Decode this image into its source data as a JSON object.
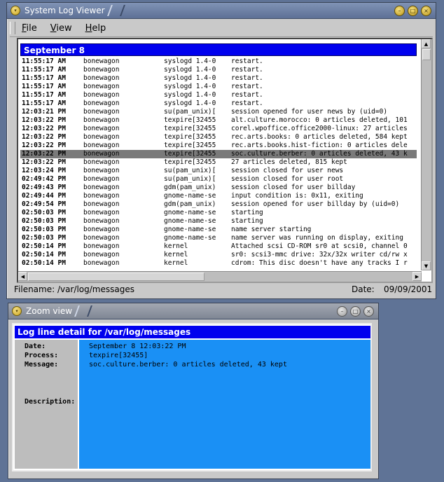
{
  "main_window": {
    "title": "System Log Viewer",
    "menu": [
      {
        "underline": "F",
        "rest": "ile"
      },
      {
        "underline": "V",
        "rest": "iew"
      },
      {
        "underline": "H",
        "rest": "elp"
      }
    ],
    "date_header": "September  8",
    "rows": [
      [
        "11:55:17 AM",
        "bonewagon",
        "syslogd 1.4-0",
        "restart."
      ],
      [
        "11:55:17 AM",
        "bonewagon",
        "syslogd 1.4-0",
        "restart."
      ],
      [
        "11:55:17 AM",
        "bonewagon",
        "syslogd 1.4-0",
        "restart."
      ],
      [
        "11:55:17 AM",
        "bonewagon",
        "syslogd 1.4-0",
        "restart."
      ],
      [
        "11:55:17 AM",
        "bonewagon",
        "syslogd 1.4-0",
        "restart."
      ],
      [
        "11:55:17 AM",
        "bonewagon",
        "syslogd 1.4-0",
        "restart."
      ],
      [
        "12:03:21 PM",
        "bonewagon",
        "su(pam_unix)[",
        "session opened for user news by (uid=0)"
      ],
      [
        "12:03:22 PM",
        "bonewagon",
        "texpire[32455",
        "alt.culture.morocco: 0 articles deleted, 101"
      ],
      [
        "12:03:22 PM",
        "bonewagon",
        "texpire[32455",
        "corel.wpoffice.office2000-linux: 27 articles"
      ],
      [
        "12:03:22 PM",
        "bonewagon",
        "texpire[32455",
        "rec.arts.books: 0 articles deleted, 584 kept"
      ],
      [
        "12:03:22 PM",
        "bonewagon",
        "texpire[32455",
        "rec.arts.books.hist-fiction: 0 articles dele"
      ],
      [
        "12:03:22 PM",
        "bonewagon",
        "texpire[32455",
        "soc.culture.berber: 0 articles deleted, 43 k"
      ],
      [
        "12:03:22 PM",
        "bonewagon",
        "texpire[32455",
        "27 articles deleted, 815 kept"
      ],
      [
        "12:03:24 PM",
        "bonewagon",
        "su(pam_unix)[",
        "session closed for user news"
      ],
      [
        "02:49:42 PM",
        "bonewagon",
        "su(pam_unix)[",
        "session closed for user root"
      ],
      [
        "02:49:43 PM",
        "bonewagon",
        "gdm(pam_unix)",
        "session closed for user billday"
      ],
      [
        "02:49:44 PM",
        "bonewagon",
        "gnome-name-se",
        "input condition is: 0x11, exiting"
      ],
      [
        "02:49:54 PM",
        "bonewagon",
        "gdm(pam_unix)",
        "session opened for user billday by (uid=0)"
      ],
      [
        "02:50:03 PM",
        "bonewagon",
        "gnome-name-se",
        "starting"
      ],
      [
        "02:50:03 PM",
        "bonewagon",
        "gnome-name-se",
        "starting"
      ],
      [
        "02:50:03 PM",
        "bonewagon",
        "gnome-name-se",
        "name server starting"
      ],
      [
        "02:50:03 PM",
        "bonewagon",
        "gnome-name-se",
        "name server was running on display, exiting"
      ],
      [
        "02:50:14 PM",
        "bonewagon",
        "kernel",
        "Attached scsi CD-ROM sr0 at scsi0, channel 0"
      ],
      [
        "02:50:14 PM",
        "bonewagon",
        "kernel",
        "sr0: scsi3-mmc drive: 32x/32x writer cd/rw x"
      ],
      [
        "02:50:14 PM",
        "bonewagon",
        "kernel",
        "cdrom: This disc doesn't have any tracks I r"
      ]
    ],
    "selected_row": 11,
    "status": {
      "filename": "Filename: /var/log/messages",
      "date_label": "Date:",
      "date": "09/09/2001"
    }
  },
  "zoom_window": {
    "title": "Zoom view",
    "header": "Log line detail for /var/log/messages",
    "labels": {
      "date": "Date:",
      "process": "Process:",
      "message": "Message:",
      "description": "Description:"
    },
    "values": {
      "date": "September  8 12:03:22 PM",
      "process": "texpire[32455]",
      "message": "soc.culture.berber: 0 articles deleted, 43 kept"
    }
  }
}
